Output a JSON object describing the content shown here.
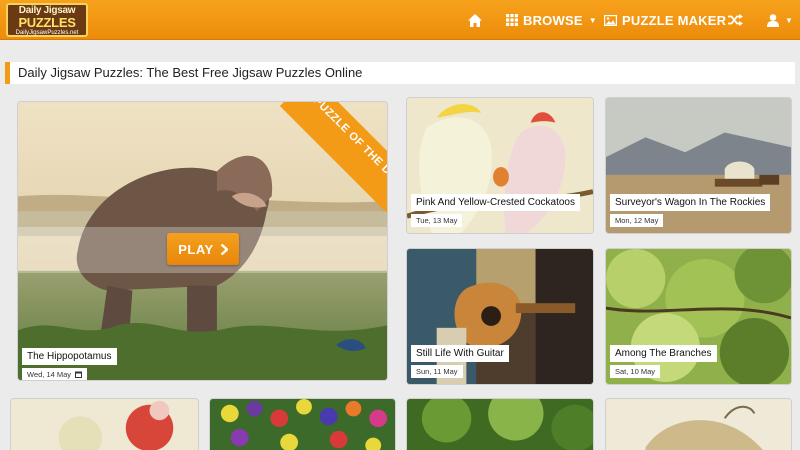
{
  "nav": {
    "logo_line1": "Daily Jigsaw",
    "logo_line2": "PUZZLES",
    "logo_line3": "DailyJigsawPuzzles.net",
    "browse_label": "BROWSE",
    "puzzle_maker_label": "PUZZLE MAKER",
    "icons": [
      "home-icon",
      "grid-icon",
      "picture-icon",
      "shuffle-icon",
      "user-icon"
    ]
  },
  "page_title": "Daily Jigsaw Puzzles: The Best Free Jigsaw Puzzles Online",
  "puzzle_of_day": {
    "ribbon": "PUZZLE OF THE DAY",
    "play_label": "PLAY",
    "title": "The Hippopotamus",
    "date": "Wed, 14 May"
  },
  "tiles": [
    {
      "title": "Pink And Yellow-Crested Cockatoos",
      "date": "Tue, 13 May"
    },
    {
      "title": "Surveyor's Wagon In The Rockies",
      "date": "Mon, 12 May"
    },
    {
      "title": "Still Life With Guitar",
      "date": "Sun, 11 May"
    },
    {
      "title": "Among The Branches",
      "date": "Sat, 10 May"
    }
  ],
  "colors": {
    "accent": "#f39a17",
    "navbar": "#ec8c0b",
    "background": "#ebebeb"
  }
}
